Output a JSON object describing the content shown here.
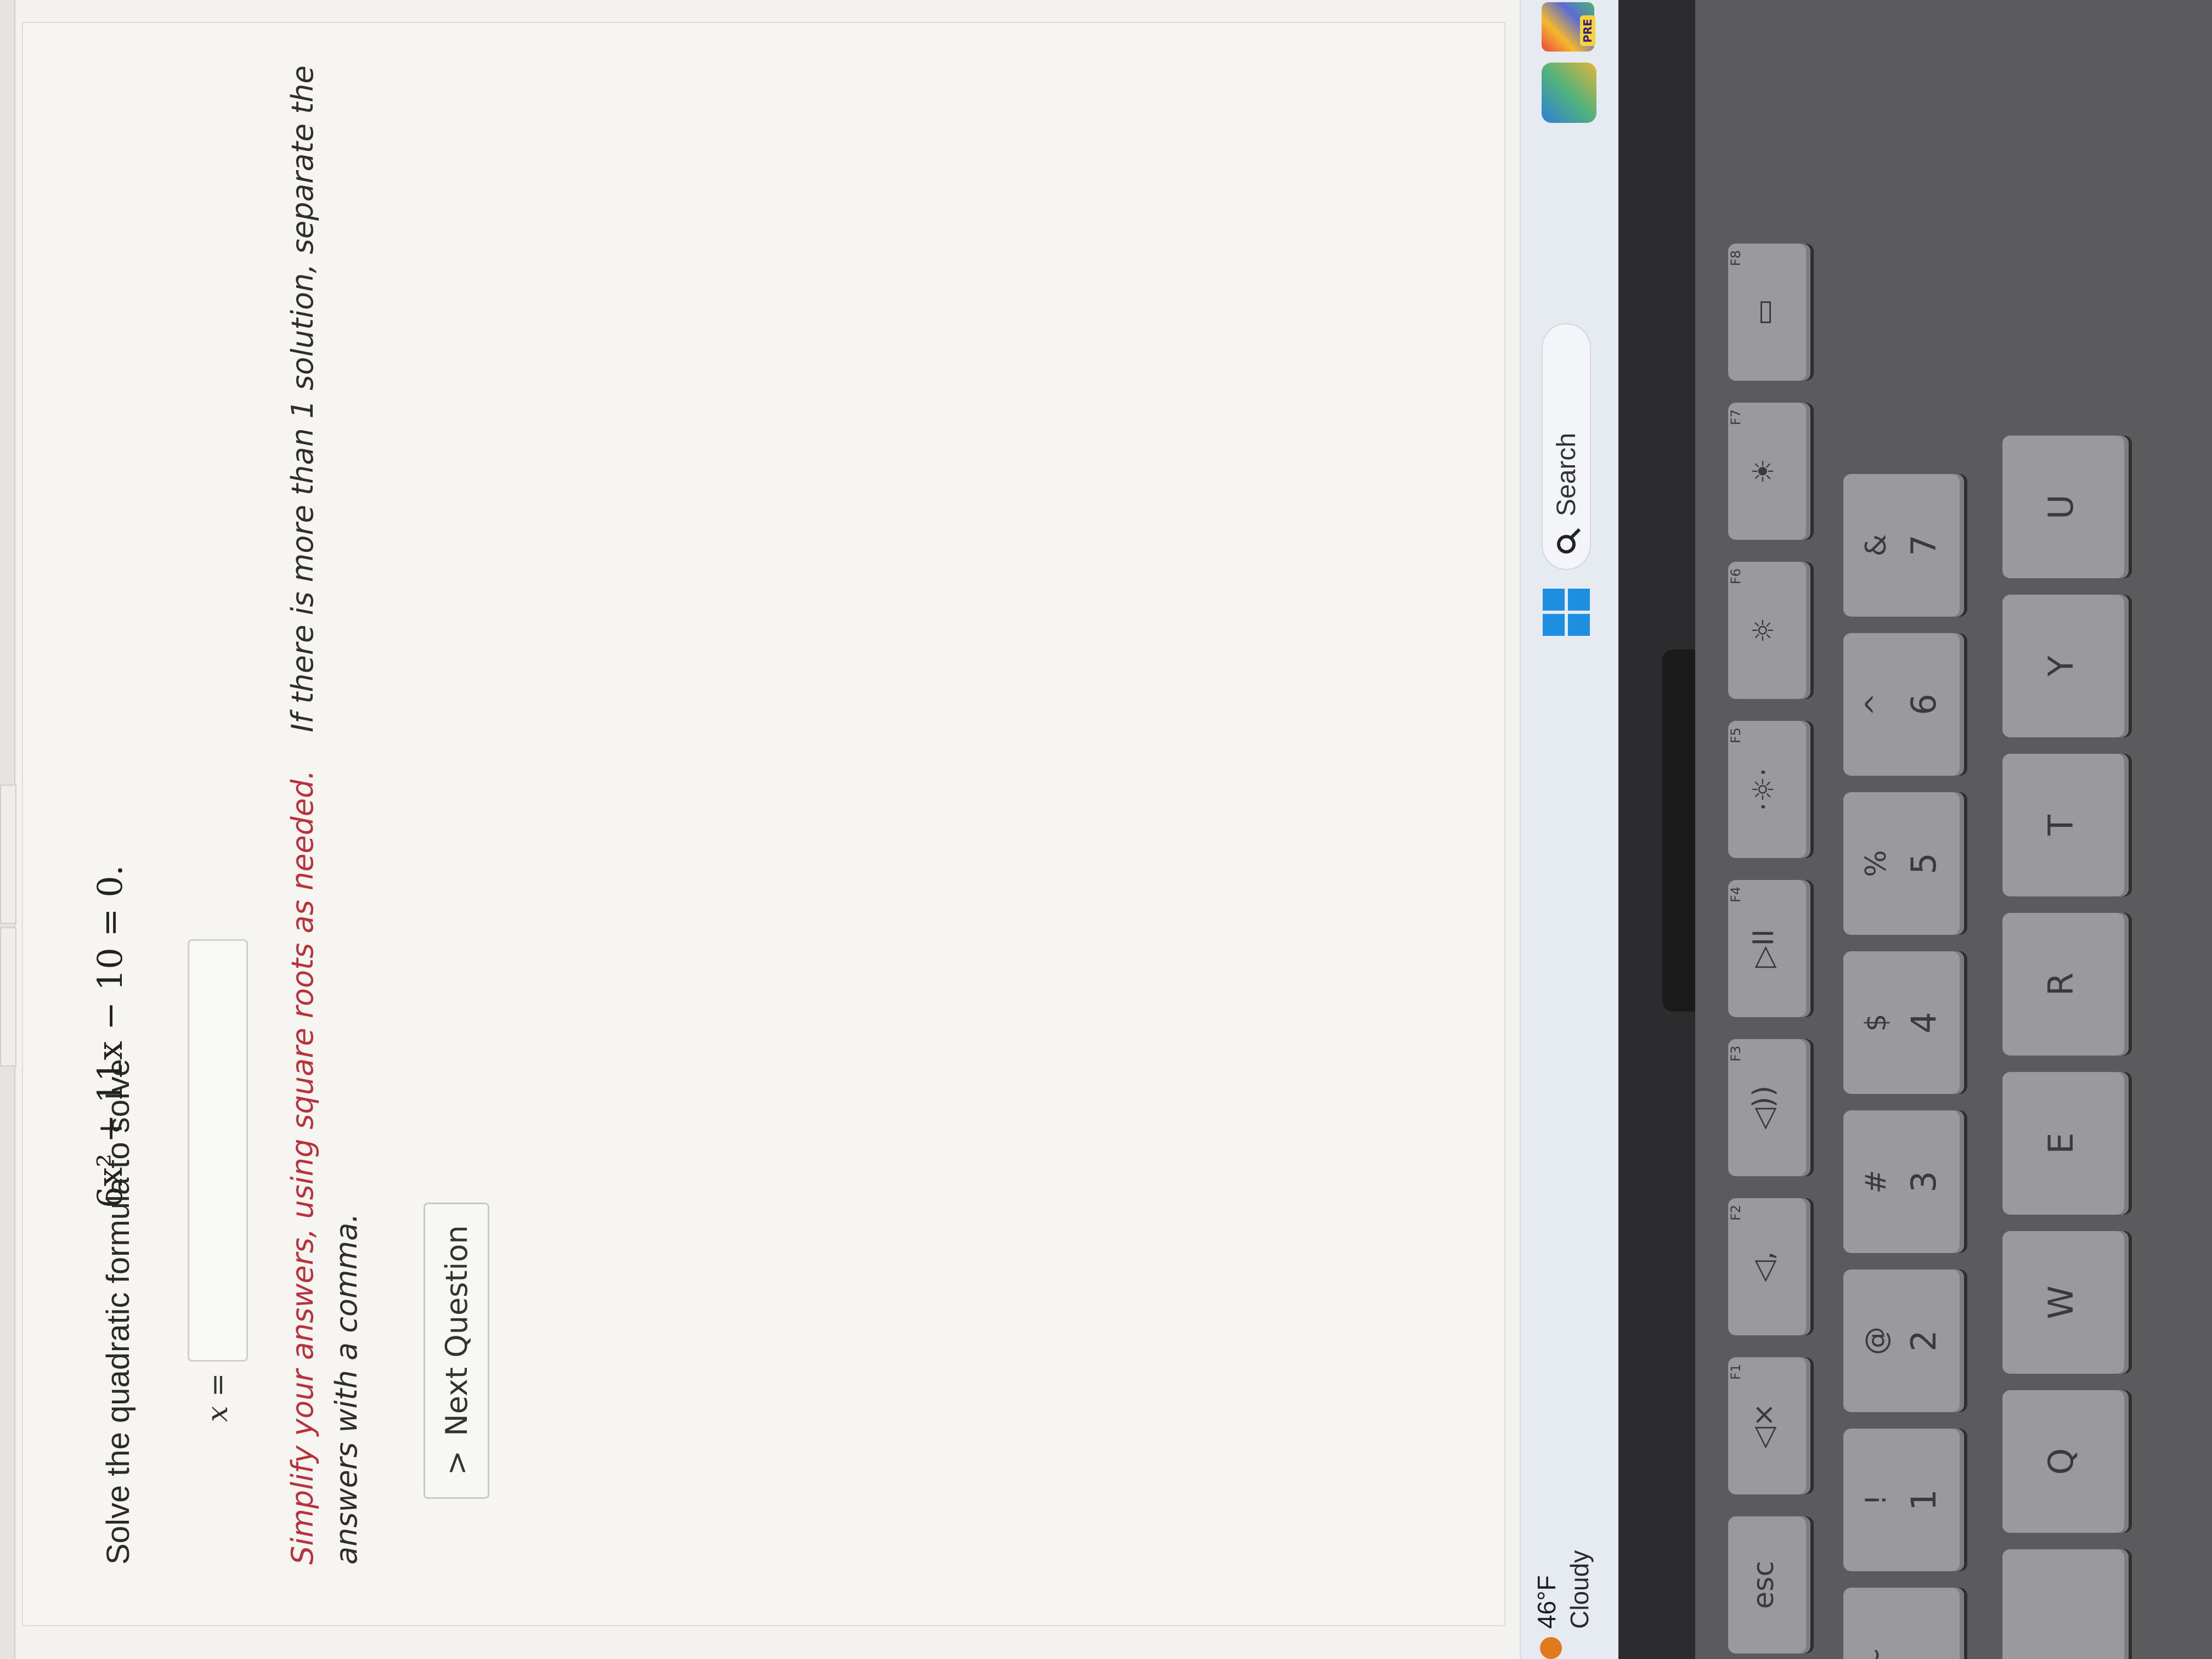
{
  "question": {
    "prompt": "Solve the quadratic formula to solve",
    "equation_html": "6x² + 11x − 10 = 0."
  },
  "answer": {
    "label": "x =",
    "value": "",
    "placeholder": ""
  },
  "hint": {
    "red_part": "Simplify your answers, using square roots as needed.",
    "dark_part": "If there is more than 1 solution, separate the answers with a comma."
  },
  "next_button": {
    "label": "Next Question",
    "icon": "chevron-right-icon"
  },
  "taskbar": {
    "weather_temp": "46°F",
    "weather_desc": "Cloudy",
    "search_label": "Search",
    "pre_badge": "PRE"
  },
  "keyboard": {
    "fn_row": [
      {
        "label": "esc",
        "fn": ""
      },
      {
        "label": "◁×",
        "fn": "F1"
      },
      {
        "label": "◁,",
        "fn": "F2"
      },
      {
        "label": "◁))",
        "fn": "F3"
      },
      {
        "label": "▷II",
        "fn": "F4"
      },
      {
        "label": "·☼·",
        "fn": "F5"
      },
      {
        "label": "☼",
        "fn": "F6"
      },
      {
        "label": "☀",
        "fn": "F7"
      },
      {
        "label": "▭",
        "fn": "F8"
      }
    ],
    "num_row": [
      {
        "top": "~",
        "main": ""
      },
      {
        "top": "!",
        "main": "1"
      },
      {
        "top": "@",
        "main": "2"
      },
      {
        "top": "#",
        "main": "3"
      },
      {
        "top": "$",
        "main": "4"
      },
      {
        "top": "%",
        "main": "5"
      },
      {
        "top": "^",
        "main": "6"
      },
      {
        "top": "&",
        "main": "7"
      }
    ],
    "letter_row": [
      "",
      "Q",
      "W",
      "E",
      "R",
      "T",
      "Y",
      "U"
    ]
  }
}
